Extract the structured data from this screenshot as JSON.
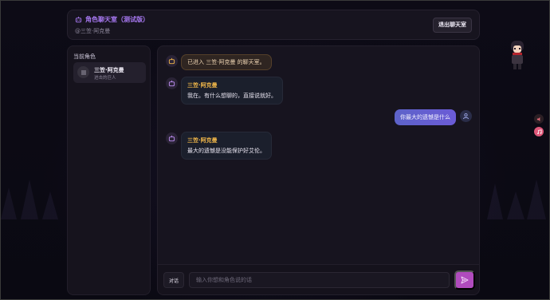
{
  "header": {
    "title": "角色聊天室（测试版）",
    "subtitle": "@三笠·阿克曼",
    "exit_label": "退出聊天室"
  },
  "sidebar": {
    "title": "当前角色",
    "role": {
      "name": "三笠·阿克曼",
      "subtitle": "进击的巨人",
      "icon": "menu-lines-icon"
    }
  },
  "messages": [
    {
      "type": "system",
      "text": "已进入 三笠·阿克曼 的聊天室。"
    },
    {
      "type": "bot",
      "name": "三笠·阿克曼",
      "text": "我在。有什么想聊的，直接说就好。"
    },
    {
      "type": "user",
      "text": "你最大的遗憾是什么"
    },
    {
      "type": "bot",
      "name": "三笠·阿克曼",
      "text": "最大的遗憾是没能保护好艾伦。"
    }
  ],
  "input": {
    "mode_label": "对话",
    "placeholder": "输入你想和角色说的话",
    "value": ""
  },
  "colors": {
    "accent": "#a879f2",
    "role_name": "#f2b84a",
    "user_bubble": "#6360d0",
    "send_button": "#b04bbd"
  }
}
